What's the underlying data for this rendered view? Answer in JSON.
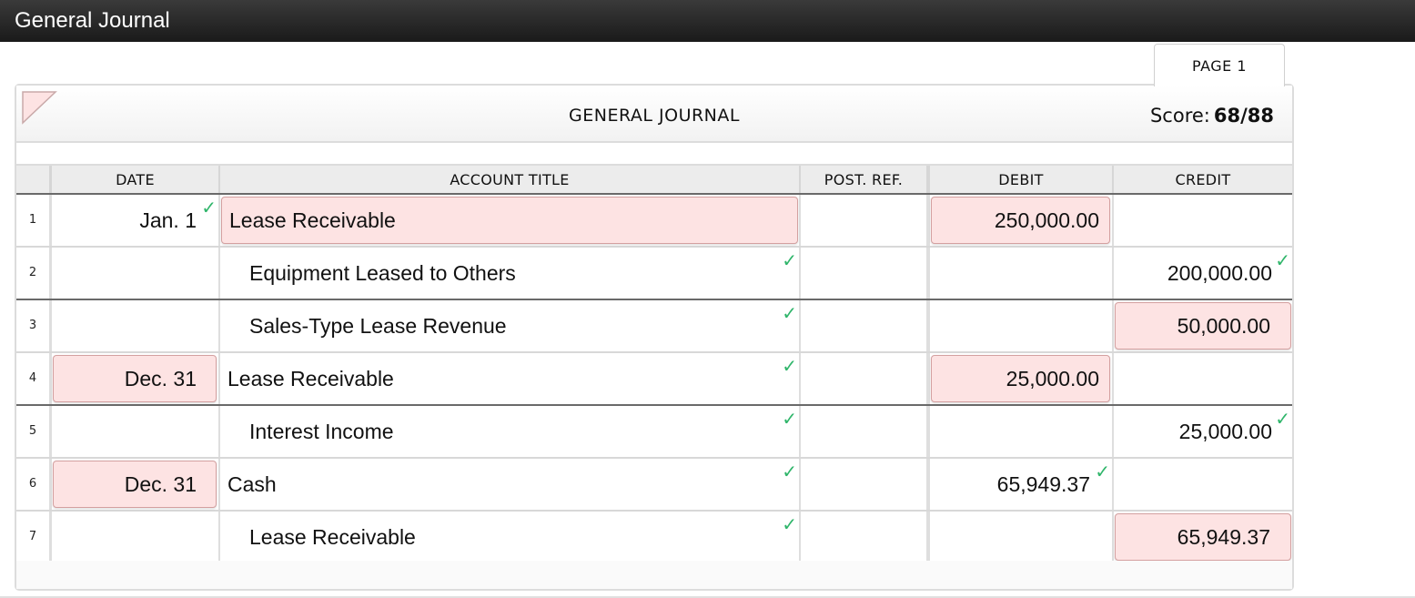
{
  "window": {
    "title": "General Journal"
  },
  "tab": {
    "label": "PAGE 1"
  },
  "journal": {
    "title": "GENERAL JOURNAL",
    "score_label": "Score:",
    "score_value": "68/88"
  },
  "columns": {
    "date": "DATE",
    "account_title": "ACCOUNT TITLE",
    "post_ref": "POST. REF.",
    "debit": "DEBIT",
    "credit": "CREDIT"
  },
  "rows": [
    {
      "num": "1",
      "date": "Jan. 1",
      "account": "Lease Receivable",
      "debit": "250,000.00",
      "credit": ""
    },
    {
      "num": "2",
      "date": "",
      "account": "Equipment Leased to Others",
      "debit": "",
      "credit": "200,000.00"
    },
    {
      "num": "3",
      "date": "",
      "account": "Sales-Type Lease Revenue",
      "debit": "",
      "credit": "50,000.00"
    },
    {
      "num": "4",
      "date": "Dec. 31",
      "account": "Lease Receivable",
      "debit": "25,000.00",
      "credit": ""
    },
    {
      "num": "5",
      "date": "",
      "account": "Interest Income",
      "debit": "",
      "credit": "25,000.00"
    },
    {
      "num": "6",
      "date": "Dec. 31",
      "account": "Cash",
      "debit": "65,949.37",
      "credit": ""
    },
    {
      "num": "7",
      "date": "",
      "account": "Lease Receivable",
      "debit": "",
      "credit": "65,949.37"
    }
  ],
  "colors": {
    "correct_check": "#2fb56a",
    "incorrect_fill": "#fde3e3",
    "incorrect_border": "#d4a0a0"
  },
  "icons": {
    "correct": "checkmark-icon",
    "corner": "corner-fold-icon"
  }
}
